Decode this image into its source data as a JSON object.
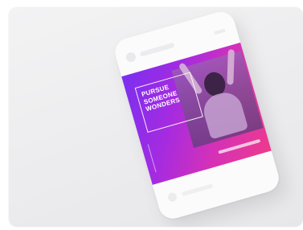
{
  "post": {
    "headline": "PURSUE\nSOMEONE\nWONDERS"
  },
  "colors": {
    "gradient_start": "#7a2ff0",
    "gradient_end": "#ee3a8c",
    "card_background": "#efeff1",
    "phone_background": "#fbfbfc"
  }
}
